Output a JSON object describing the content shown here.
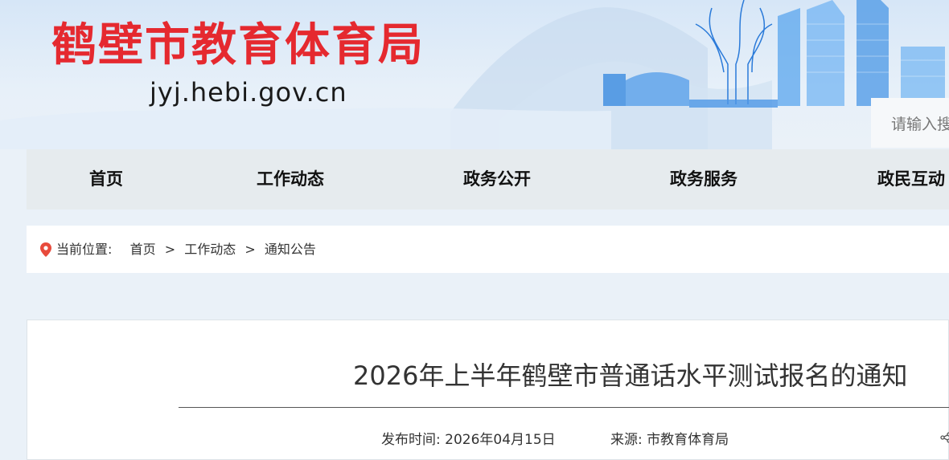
{
  "header": {
    "site_title": "鹤壁市教育体育局",
    "site_domain": "jyj.hebi.gov.cn",
    "search_placeholder": "请输入搜",
    "title_color": "#e5292f"
  },
  "nav": {
    "items": [
      {
        "label": "首页"
      },
      {
        "label": "工作动态"
      },
      {
        "label": "政务公开"
      },
      {
        "label": "政务服务"
      },
      {
        "label": "政民互动"
      }
    ]
  },
  "breadcrumb": {
    "prefix": "当前位置:",
    "icon": "location-pin-icon",
    "items": [
      {
        "label": "首页"
      },
      {
        "label": "工作动态"
      },
      {
        "label": "通知公告"
      }
    ],
    "separator": ">"
  },
  "article": {
    "title": "2026年上半年鹤壁市普通话水平测试报名的通知",
    "publish_label": "发布时间:",
    "publish_date": "2026年04月15日",
    "source_label": "来源:",
    "source": "市教育体育局",
    "share_icon": "share-icon"
  }
}
